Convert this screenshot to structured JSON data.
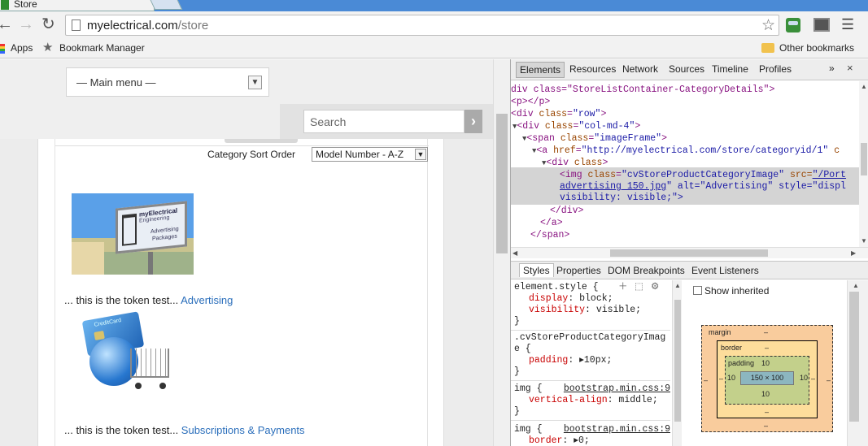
{
  "browser": {
    "tab_title": "Store",
    "url_host": "myelectrical.com",
    "url_path": "/store",
    "bookmarks": {
      "apps": "Apps",
      "bookmark_manager": "Bookmark Manager",
      "other": "Other bookmarks"
    }
  },
  "page": {
    "main_menu": "— Main menu —",
    "search_placeholder": "Search",
    "sort_label": "Category Sort Order",
    "sort_value": "Model Number - A-Z",
    "billboard": {
      "line1": "myElectrical",
      "line2": "Engineering",
      "line3": "Advertising",
      "line4": "Packages"
    },
    "card_text": "CreditCard",
    "items": [
      {
        "prefix": "... this is the token test... ",
        "link": "Advertising"
      },
      {
        "prefix": "... this is the token test... ",
        "link": "Subscriptions & Payments"
      }
    ]
  },
  "devtools": {
    "tabs": [
      "Elements",
      "Resources",
      "Network",
      "Sources",
      "Timeline",
      "Profiles"
    ],
    "more": "»",
    "close": "×",
    "dom": {
      "l0": "div class=\"StoreListContainer-CategoryDetails\">",
      "l1": "<p></p>",
      "l2_tag": "<div ",
      "l2_attr": "class",
      "l2_val": "\"row\"",
      "l3_tag": "<div ",
      "l3_attr": "class",
      "l3_val": "\"col-md-4\"",
      "l4_tag": "<span ",
      "l4_attr": "class",
      "l4_val": "\"imageFrame\"",
      "l5_tag": "<a ",
      "l5_attr": "href",
      "l5_val": "\"http://myelectrical.com/store/categoryid/1\"",
      "l5_tail": " c",
      "l6_tag": "<div ",
      "l6_attr": "class",
      "l7_tag": "<img ",
      "l7_attr": "class",
      "l7_val": "\"cvStoreProductCategoryImage\"",
      "l7_src": " src=",
      "l7_link": "\"/Port",
      "l8_link": "advertising 150.jpg",
      "l8_rest": "\" alt=\"Advertising\" style=\"displ",
      "l9": "visibility: visible;\">",
      "l10": "</div>",
      "l11": "</a>",
      "l12": "</span>"
    },
    "style_tabs": [
      "Styles",
      "Properties",
      "DOM Breakpoints",
      "Event Listeners"
    ],
    "styles": {
      "r1_sel": "element.style {",
      "r1_p1": "display",
      "r1_v1": ": block;",
      "r1_p2": "visibility",
      "r1_v2": ": visible;",
      "r2_sel1": ".cvStoreProductCategoryImag",
      "r2_sel2": "e {",
      "r2_p1": "padding",
      "r2_v1": ": ▸10px;",
      "r3_sel": "img {",
      "r3_src": "bootstrap.min.css:9",
      "r3_p1": "vertical-align",
      "r3_v1": ": middle;",
      "r4_sel": "img {",
      "r4_src": "bootstrap.min.css:9",
      "r4_p1": "border",
      "r4_v1": ": ▸0;",
      "close": "}"
    },
    "metrics": {
      "show_inherited": "Show inherited",
      "margin_label": "margin",
      "border_label": "border",
      "padding_label": "padding",
      "padding_top": "10",
      "padding_left": "10",
      "padding_right": "10",
      "padding_bottom": "10",
      "content": "150 × 100",
      "dash": "–"
    }
  }
}
